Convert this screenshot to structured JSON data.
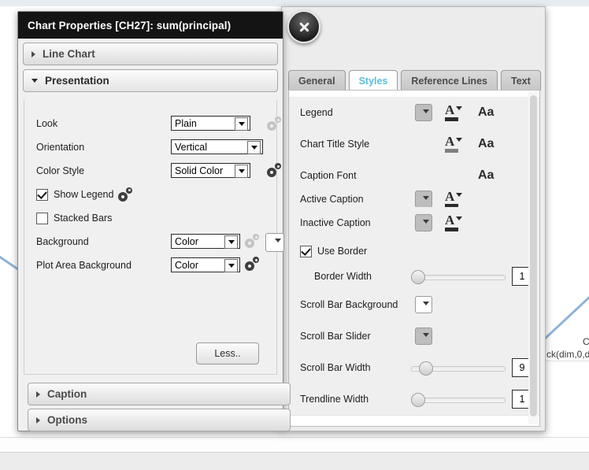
{
  "background": {
    "expression_text": "ck(dim,0,d",
    "corner_letter": "C"
  },
  "close_button": {
    "label": "Close",
    "icon": "close-icon"
  },
  "left_dialog": {
    "title": "Chart Properties [CH27]: sum(principal)",
    "sections": [
      {
        "label": "Line Chart",
        "expanded": false
      },
      {
        "label": "Presentation",
        "expanded": true
      },
      {
        "label": "Caption",
        "expanded": false
      },
      {
        "label": "Options",
        "expanded": false
      }
    ],
    "presentation": {
      "look": {
        "label": "Look",
        "value": "Plain",
        "options": [
          "Plain"
        ],
        "gear_enabled": false
      },
      "orientation": {
        "label": "Orientation",
        "value": "Vertical",
        "options": [
          "Vertical"
        ]
      },
      "color_style": {
        "label": "Color Style",
        "value": "Solid Color",
        "options": [
          "Solid Color"
        ],
        "gear_enabled": true
      },
      "show_legend": {
        "label": "Show Legend",
        "checked": true,
        "gear_enabled": true
      },
      "stacked_bars": {
        "label": "Stacked Bars",
        "checked": false
      },
      "background": {
        "label": "Background",
        "value": "Color",
        "options": [
          "Color"
        ],
        "gear_enabled": false,
        "swatch": "#ffffff"
      },
      "plot_area_background": {
        "label": "Plot Area Background",
        "value": "Color",
        "options": [
          "Color"
        ],
        "gear_enabled": true
      }
    },
    "less_button": "Less.."
  },
  "right_dialog": {
    "tabs": [
      {
        "label": "General",
        "active": false
      },
      {
        "label": "Styles",
        "active": true
      },
      {
        "label": "Reference Lines",
        "active": false
      },
      {
        "label": "Text",
        "active": false
      }
    ],
    "active_tab_color": "#5bc0de",
    "styles_rows": [
      {
        "name": "Legend",
        "swatch": "#c0c0c0",
        "font_color": true,
        "font_color_bar": "#2b2b2b",
        "aa": "Aa"
      },
      {
        "name": "Chart Title Style",
        "font_color": true,
        "font_color_bar": "#808080",
        "aa": "Aa"
      },
      {
        "name": "Caption Font",
        "aa": "Aa"
      },
      {
        "name": "Active Caption",
        "swatch": "#c0c0c0",
        "font_color": true,
        "font_color_bar": "#2b2b2b"
      },
      {
        "name": "Inactive Caption",
        "swatch": "#c0c0c0",
        "font_color": true,
        "font_color_bar": "#2b2b2b"
      }
    ],
    "use_border": {
      "label": "Use Border",
      "checked": true
    },
    "border_width": {
      "label": "Border Width",
      "value": "1",
      "slider_percent": 0
    },
    "scroll_bar_background": {
      "label": "Scroll Bar Background",
      "swatch": "#ffffff"
    },
    "scroll_bar_slider": {
      "label": "Scroll Bar Slider",
      "swatch": "#bdbdbd"
    },
    "scroll_bar_width": {
      "label": "Scroll Bar Width",
      "value": "9",
      "slider_percent": 12
    },
    "trendline_width": {
      "label": "Trendline Width",
      "value": "1",
      "slider_percent": 0
    }
  }
}
